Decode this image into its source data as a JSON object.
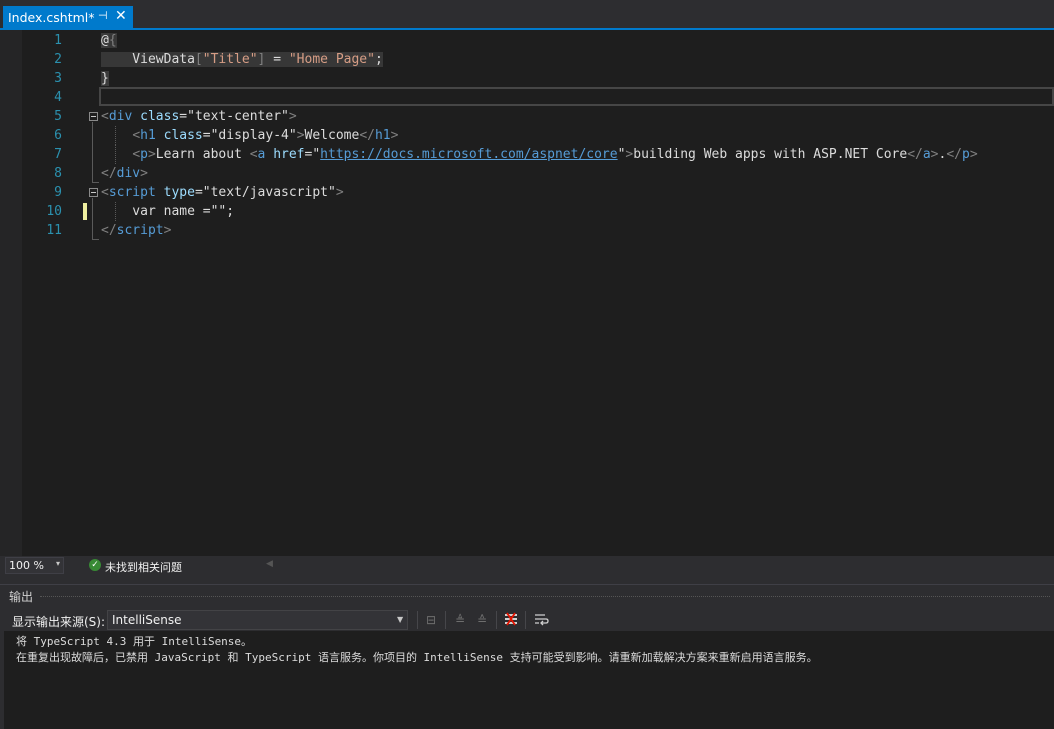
{
  "tab": {
    "title": "Index.cshtml*",
    "pin_glyph": "⊣",
    "close_glyph": "✕"
  },
  "editor": {
    "lines": [
      {
        "n": "1",
        "tokens": [
          {
            "c": "t-razor",
            "t": "@"
          },
          {
            "c": "t-gray hl-block",
            "t": "{"
          }
        ]
      },
      {
        "n": "2",
        "tokens": [
          {
            "c": "t-txt hl-block",
            "t": "    ViewData"
          },
          {
            "c": "t-gray hl-block",
            "t": "["
          },
          {
            "c": "t-str hl-block",
            "t": "\"Title\""
          },
          {
            "c": "t-gray hl-block",
            "t": "]"
          },
          {
            "c": "t-txt hl-block",
            "t": " = "
          },
          {
            "c": "t-str hl-block",
            "t": "\"Home Page\""
          },
          {
            "c": "t-txt hl-block",
            "t": ";"
          }
        ]
      },
      {
        "n": "3",
        "tokens": [
          {
            "c": "t-razor",
            "t": "}"
          }
        ]
      },
      {
        "n": "4",
        "tokens": []
      },
      {
        "n": "5",
        "tokens": [
          {
            "c": "t-gray",
            "t": "<"
          },
          {
            "c": "t-tag",
            "t": "div"
          },
          {
            "c": "t-txt",
            "t": " "
          },
          {
            "c": "t-attr",
            "t": "class"
          },
          {
            "c": "t-txt",
            "t": "=\""
          },
          {
            "c": "t-txt",
            "t": "text-center"
          },
          {
            "c": "t-txt",
            "t": "\""
          },
          {
            "c": "t-gray",
            "t": ">"
          }
        ]
      },
      {
        "n": "6",
        "tokens": [
          {
            "c": "t-txt",
            "t": "    "
          },
          {
            "c": "t-gray",
            "t": "<"
          },
          {
            "c": "t-tag",
            "t": "h1"
          },
          {
            "c": "t-txt",
            "t": " "
          },
          {
            "c": "t-attr",
            "t": "class"
          },
          {
            "c": "t-txt",
            "t": "=\"display-4\""
          },
          {
            "c": "t-gray",
            "t": ">"
          },
          {
            "c": "t-txt",
            "t": "Welcome"
          },
          {
            "c": "t-gray",
            "t": "</"
          },
          {
            "c": "t-tag",
            "t": "h1"
          },
          {
            "c": "t-gray",
            "t": ">"
          }
        ]
      },
      {
        "n": "7",
        "tokens": [
          {
            "c": "t-txt",
            "t": "    "
          },
          {
            "c": "t-gray",
            "t": "<"
          },
          {
            "c": "t-tag",
            "t": "p"
          },
          {
            "c": "t-gray",
            "t": ">"
          },
          {
            "c": "t-txt",
            "t": "Learn about "
          },
          {
            "c": "t-gray",
            "t": "<"
          },
          {
            "c": "t-tag",
            "t": "a"
          },
          {
            "c": "t-txt",
            "t": " "
          },
          {
            "c": "t-attr",
            "t": "href"
          },
          {
            "c": "t-txt",
            "t": "=\""
          },
          {
            "c": "t-link",
            "t": "https://docs.microsoft.com/aspnet/core"
          },
          {
            "c": "t-txt",
            "t": "\""
          },
          {
            "c": "t-gray",
            "t": ">"
          },
          {
            "c": "t-txt",
            "t": "building Web apps with ASP.NET Core"
          },
          {
            "c": "t-gray",
            "t": "</"
          },
          {
            "c": "t-tag",
            "t": "a"
          },
          {
            "c": "t-gray",
            "t": ">"
          },
          {
            "c": "t-txt",
            "t": "."
          },
          {
            "c": "t-gray",
            "t": "</"
          },
          {
            "c": "t-tag",
            "t": "p"
          },
          {
            "c": "t-gray",
            "t": ">"
          }
        ]
      },
      {
        "n": "8",
        "tokens": [
          {
            "c": "t-gray",
            "t": "</"
          },
          {
            "c": "t-tag",
            "t": "div"
          },
          {
            "c": "t-gray",
            "t": ">"
          }
        ]
      },
      {
        "n": "9",
        "tokens": [
          {
            "c": "t-gray",
            "t": "<"
          },
          {
            "c": "t-tag",
            "t": "script"
          },
          {
            "c": "t-txt",
            "t": " "
          },
          {
            "c": "t-attr",
            "t": "type"
          },
          {
            "c": "t-txt",
            "t": "=\"text/javascript\""
          },
          {
            "c": "t-gray",
            "t": ">"
          }
        ]
      },
      {
        "n": "10",
        "tokens": [
          {
            "c": "t-txt",
            "t": "    var name =\"\";"
          }
        ]
      },
      {
        "n": "11",
        "tokens": [
          {
            "c": "t-gray",
            "t": "</"
          },
          {
            "c": "t-tag",
            "t": "script"
          },
          {
            "c": "t-gray",
            "t": ">"
          }
        ]
      }
    ]
  },
  "status": {
    "zoom": "100 %",
    "zoom_arrow": "▾",
    "issues_text": "未找到相关问题",
    "ok_glyph": "✓"
  },
  "output": {
    "title": "输出",
    "source_label": "显示输出来源(S):",
    "source_value": "IntelliSense",
    "lines": [
      "将 TypeScript 4.3 用于 IntelliSense。",
      "在重复出现故障后，已禁用 JavaScript 和 TypeScript 语言服务。你项目的 IntelliSense 支持可能受到影响。请重新加载解决方案来重新启用语言服务。"
    ],
    "toolbar_icons": [
      "find-message-icon",
      "prev-message-icon",
      "next-message-icon",
      "clear-all-icon",
      "word-wrap-icon"
    ]
  }
}
